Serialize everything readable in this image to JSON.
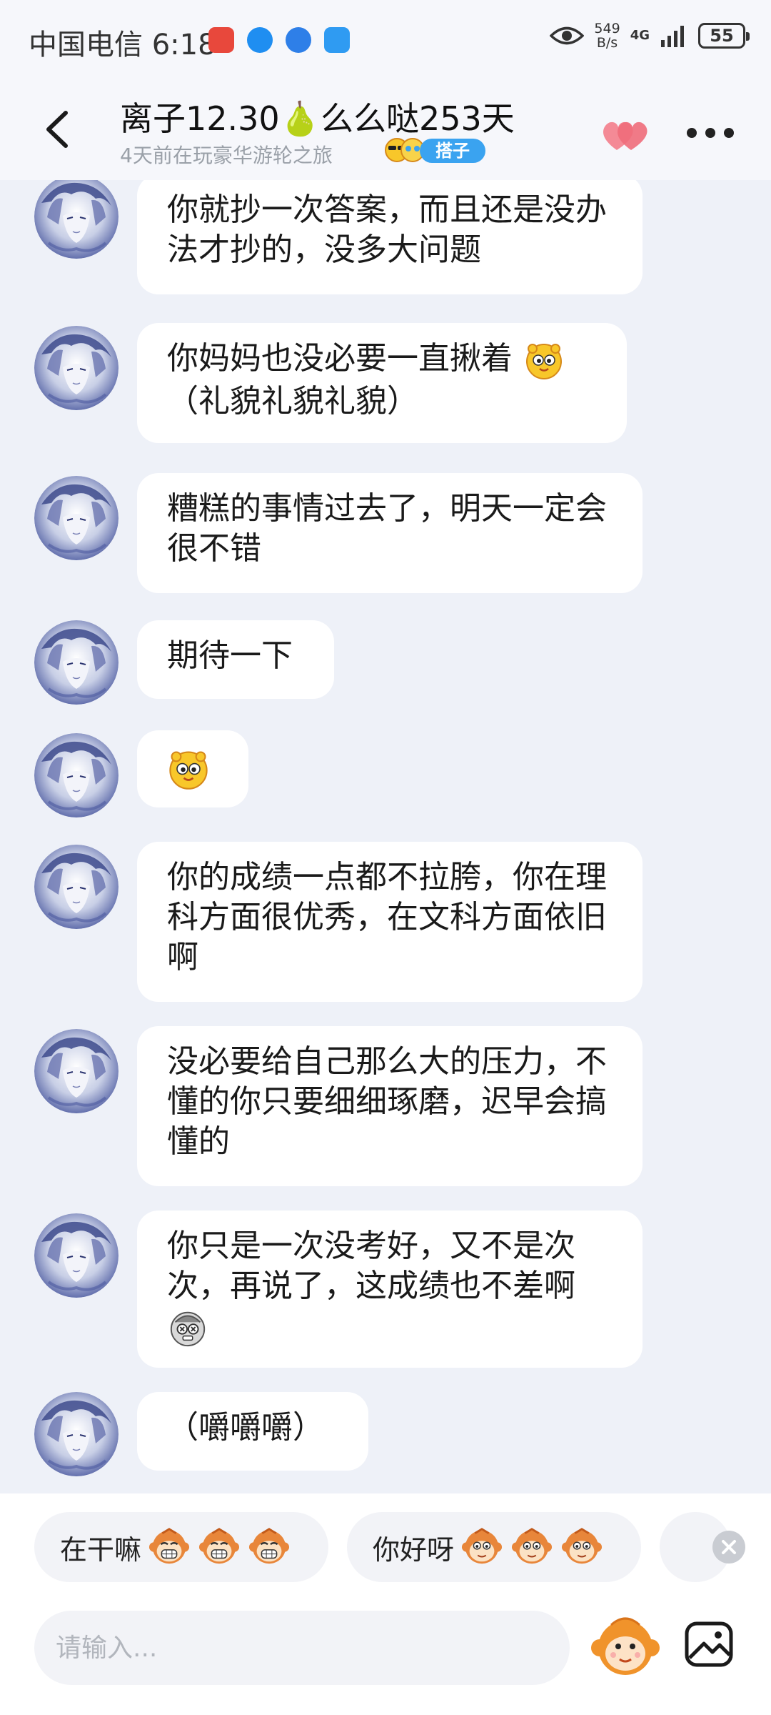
{
  "status_bar": {
    "carrier_time": "中国电信 6:18",
    "net_speed_value": "549",
    "net_speed_unit": "B/s",
    "network_type": "4G",
    "battery_level": "55"
  },
  "header": {
    "title": "离子12.30🍐么么哒253天",
    "subtitle": "4天前在玩豪华游轮之旅",
    "tag": "搭子"
  },
  "messages": [
    {
      "text": "你就抄一次答案，而且还是没办法才抄的，没多大问题"
    },
    {
      "text": "你妈妈也没必要一直揪着",
      "text2": "（礼貌礼貌礼貌）",
      "emoji": "yellow-smiley-icon"
    },
    {
      "text": "糟糕的事情过去了，明天一定会很不错"
    },
    {
      "text": "期待一下"
    },
    {
      "emoji": "yellow-smiley-icon"
    },
    {
      "text": "你的成绩一点都不拉胯，你在理科方面很优秀，在文科方面依旧啊"
    },
    {
      "text": "没必要给自己那么大的压力，不懂的你只要细细琢磨，迟早会搞懂的"
    },
    {
      "text": "你只是一次没考好，又不是次次，再说了，这成绩也不差啊",
      "emoji": "gray-dizzy-face-icon"
    },
    {
      "text": "（嚼嚼嚼）"
    }
  ],
  "quick_replies": [
    {
      "label": "在干嘛",
      "emoji": "grinning-monkey-icon"
    },
    {
      "label": "你好呀",
      "emoji": "monkey-face-icon"
    }
  ],
  "input": {
    "placeholder": "请输入..."
  },
  "icons": {
    "back": "chevron-left-icon",
    "hearts": "double-heart-icon",
    "more": "more-dots-icon",
    "mascot": "mascot-icon",
    "gallery": "gallery-icon"
  },
  "colors": {
    "chat_background": "#eef1f8",
    "bubble": "#ffffff",
    "tag_badge": "#3aa3f0",
    "heart": "#f06b7a"
  }
}
